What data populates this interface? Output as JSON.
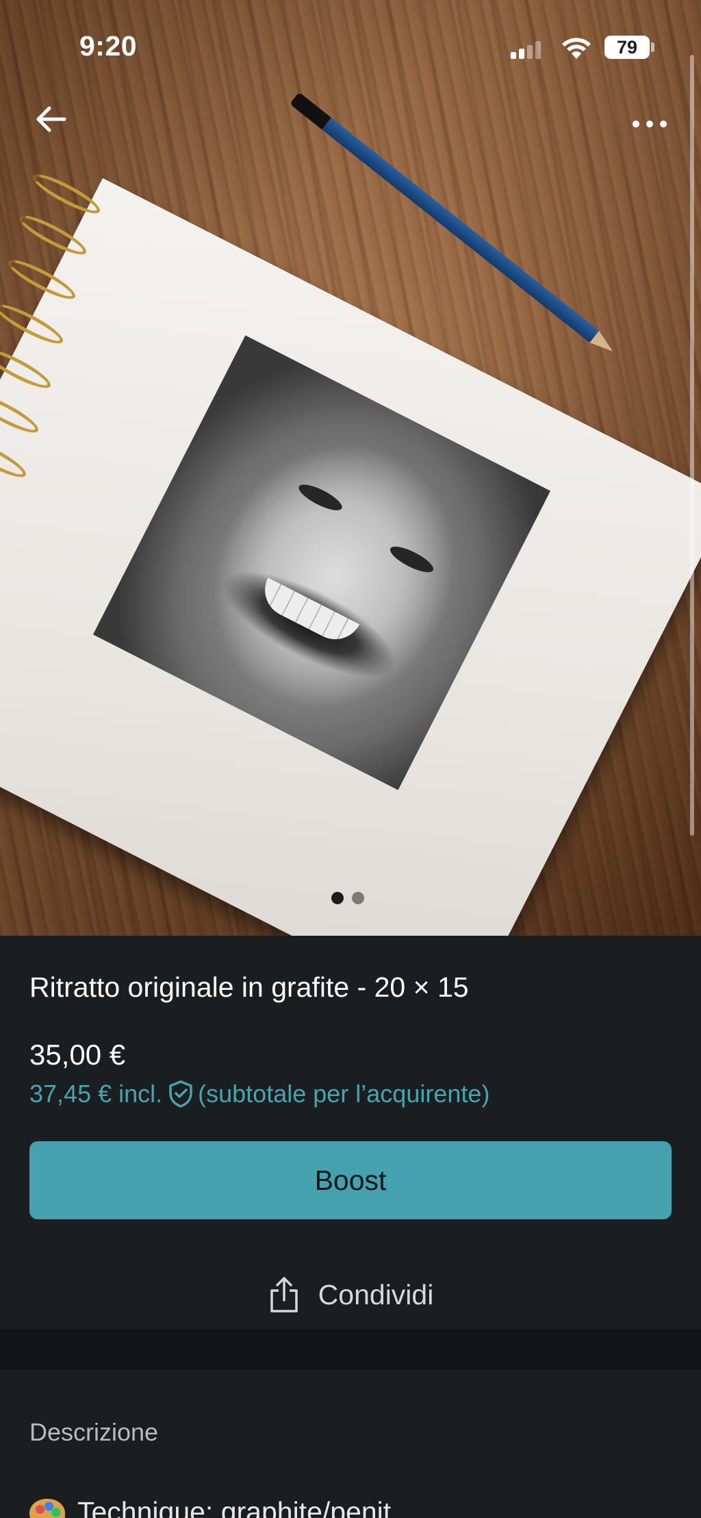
{
  "status_bar": {
    "time": "9:20",
    "battery": "79"
  },
  "nav": {
    "back_icon": "arrow-left-icon",
    "more_icon": "more-horizontal-icon"
  },
  "gallery": {
    "image_count": 2,
    "active_index": 0,
    "image_description_icon": "photo"
  },
  "listing": {
    "title": "Ritratto originale in grafite - 20 × 15",
    "price": "35,00 €",
    "price_incl": "37,45 € incl.",
    "price_incl_note": "(subtotale per l’acquirente)",
    "boost_label": "Boost",
    "share_label": "Condividi"
  },
  "description": {
    "heading": "Descrizione",
    "first_line": "Technique: graphite/penit"
  },
  "colors": {
    "background": "#1b1e20",
    "accent": "#44a1ad",
    "accent_text": "#4aa3ae"
  }
}
